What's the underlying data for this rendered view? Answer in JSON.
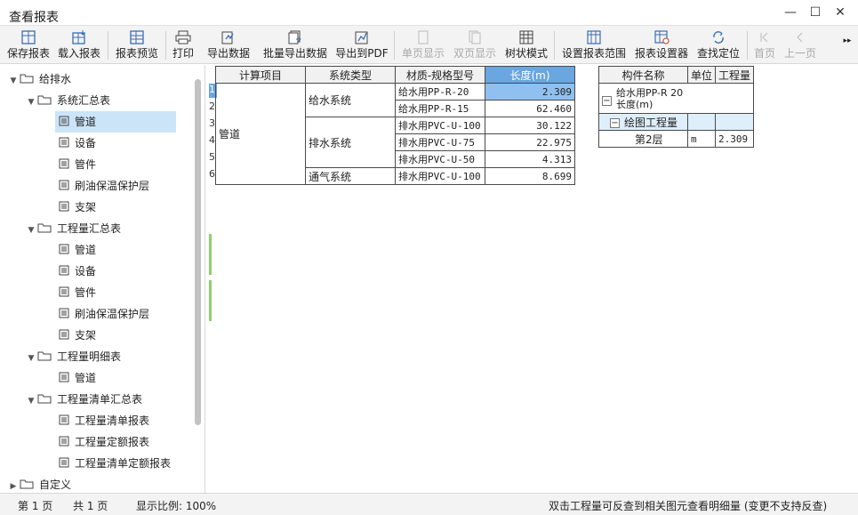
{
  "window": {
    "title": "查看报表",
    "minimize": "—",
    "maximize": "☐",
    "close": "✕"
  },
  "toolbar": {
    "buttons": [
      {
        "label": "保存报表",
        "icon": "save-report-icon"
      },
      {
        "label": "载入报表",
        "icon": "load-report-icon"
      },
      {
        "label": "报表预览",
        "icon": "preview-icon"
      },
      {
        "label": "打印",
        "icon": "printer-icon"
      },
      {
        "label": "导出数据",
        "icon": "export-data-icon"
      },
      {
        "label": "批量导出数据",
        "icon": "batch-export-icon"
      },
      {
        "label": "导出到PDF",
        "icon": "export-pdf-icon"
      },
      {
        "label": "单页显示",
        "icon": "single-page-icon",
        "disabled": true
      },
      {
        "label": "双页显示",
        "icon": "double-page-icon",
        "disabled": true
      },
      {
        "label": "树状模式",
        "icon": "tree-mode-icon"
      },
      {
        "label": "设置报表范围",
        "icon": "report-range-icon"
      },
      {
        "label": "报表设置器",
        "icon": "report-settings-icon"
      },
      {
        "label": "查找定位",
        "icon": "locate-icon"
      },
      {
        "label": "首页",
        "icon": "first-page-icon",
        "disabled": true
      },
      {
        "label": "上一页",
        "icon": "prev-page-icon",
        "disabled": true
      }
    ],
    "more": "▸▸"
  },
  "tree": {
    "root": "给排水",
    "groups": [
      {
        "label": "系统汇总表",
        "items": [
          "管道",
          "设备",
          "管件",
          "刷油保温保护层",
          "支架"
        ]
      },
      {
        "label": "工程量汇总表",
        "items": [
          "管道",
          "设备",
          "管件",
          "刷油保温保护层",
          "支架"
        ]
      },
      {
        "label": "工程量明细表",
        "items": [
          "管道"
        ]
      },
      {
        "label": "工程量清单汇总表",
        "items": [
          "工程量清单报表",
          "工程量定额报表",
          "工程量清单定额报表"
        ]
      }
    ],
    "custom": "自定义"
  },
  "report": {
    "headers": [
      "计算项目",
      "系统类型",
      "材质-规格型号",
      "长度(m)"
    ],
    "row_numbers": [
      "1",
      "2",
      "3",
      "4",
      "5",
      "6"
    ],
    "item": "管道",
    "systems": [
      "给水系统",
      "排水系统",
      "通气系统"
    ],
    "rows": [
      {
        "spec": "给水用PP-R-20",
        "length": "2.309"
      },
      {
        "spec": "给水用PP-R-15",
        "length": "62.460"
      },
      {
        "spec": "排水用PVC-U-100",
        "length": "30.122"
      },
      {
        "spec": "排水用PVC-U-75",
        "length": "22.975"
      },
      {
        "spec": "排水用PVC-U-50",
        "length": "4.313"
      },
      {
        "spec": "排水用PVC-U-100",
        "length": "8.699"
      }
    ]
  },
  "detail": {
    "headers": [
      "构件名称",
      "单位",
      "工程量"
    ],
    "root_line1": "给水用PP-R 20",
    "root_line2": "长度(m)",
    "group": "绘图工程量",
    "floor": {
      "name": "第2层",
      "unit": "m",
      "qty": "2.309"
    },
    "expander_sign": "−"
  },
  "status": {
    "page_current": "第 1 页",
    "page_total": "共 1 页",
    "zoom": "显示比例: 100%",
    "hint": "双击工程量可反查到相关图元查看明细量 (变更不支持反查)"
  }
}
